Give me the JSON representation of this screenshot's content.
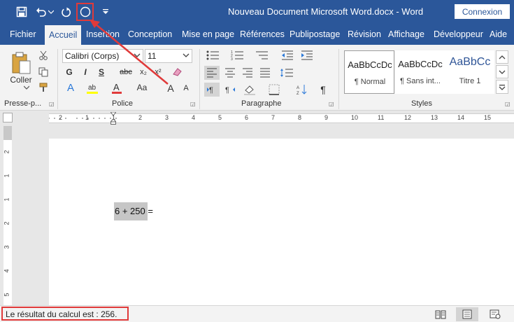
{
  "window": {
    "title": "Nouveau Document Microsoft Word.docx - Word",
    "signin_label": "Connexion"
  },
  "qat": {
    "icons": [
      "save-icon",
      "undo-icon",
      "repeat-icon",
      "circle-command-icon",
      "customize-qat-icon"
    ]
  },
  "tabs": [
    {
      "label": "Fichier"
    },
    {
      "label": "Accueil",
      "active": true
    },
    {
      "label": "Insertion"
    },
    {
      "label": "Conception"
    },
    {
      "label": "Mise en page"
    },
    {
      "label": "Références"
    },
    {
      "label": "Publipostage"
    },
    {
      "label": "Révision"
    },
    {
      "label": "Affichage"
    },
    {
      "label": "Développeur"
    },
    {
      "label": "Aide"
    }
  ],
  "ribbon": {
    "clipboard": {
      "label": "Presse-p...",
      "paste_label": "Coller"
    },
    "font": {
      "label": "Police",
      "font_name": "Calibri (Corps)",
      "font_size": "11",
      "bold": "G",
      "italic": "I",
      "underline": "S",
      "strike": "abc",
      "sub": "x₂",
      "sup": "x²",
      "case": "Aa",
      "grow": "A",
      "shrink": "A"
    },
    "paragraph": {
      "label": "Paragraphe",
      "pilcrow": "¶"
    },
    "styles": {
      "label": "Styles",
      "items": [
        {
          "sample": "AaBbCcDc",
          "name": "¶ Normal",
          "selected": true
        },
        {
          "sample": "AaBbCcDc",
          "name": "¶ Sans int..."
        },
        {
          "sample": "AaBbCc",
          "name": "Titre 1"
        }
      ]
    }
  },
  "ruler": {
    "marks": [
      "2",
      "1",
      "1",
      "2",
      "3",
      "4",
      "5",
      "6",
      "7",
      "8",
      "9",
      "10",
      "11",
      "12",
      "13",
      "14",
      "15"
    ]
  },
  "vruler": {
    "marks": [
      "2",
      "1",
      "1",
      "2",
      "3",
      "4",
      "5"
    ]
  },
  "document": {
    "text": "6 + 250 ="
  },
  "status": {
    "text": "Le résultat du calcul est : 256."
  },
  "colors": {
    "accent": "#2b579a",
    "annotation": "#e03a3a",
    "highlight": "#ffff00",
    "font_color": "#e03a3a"
  }
}
